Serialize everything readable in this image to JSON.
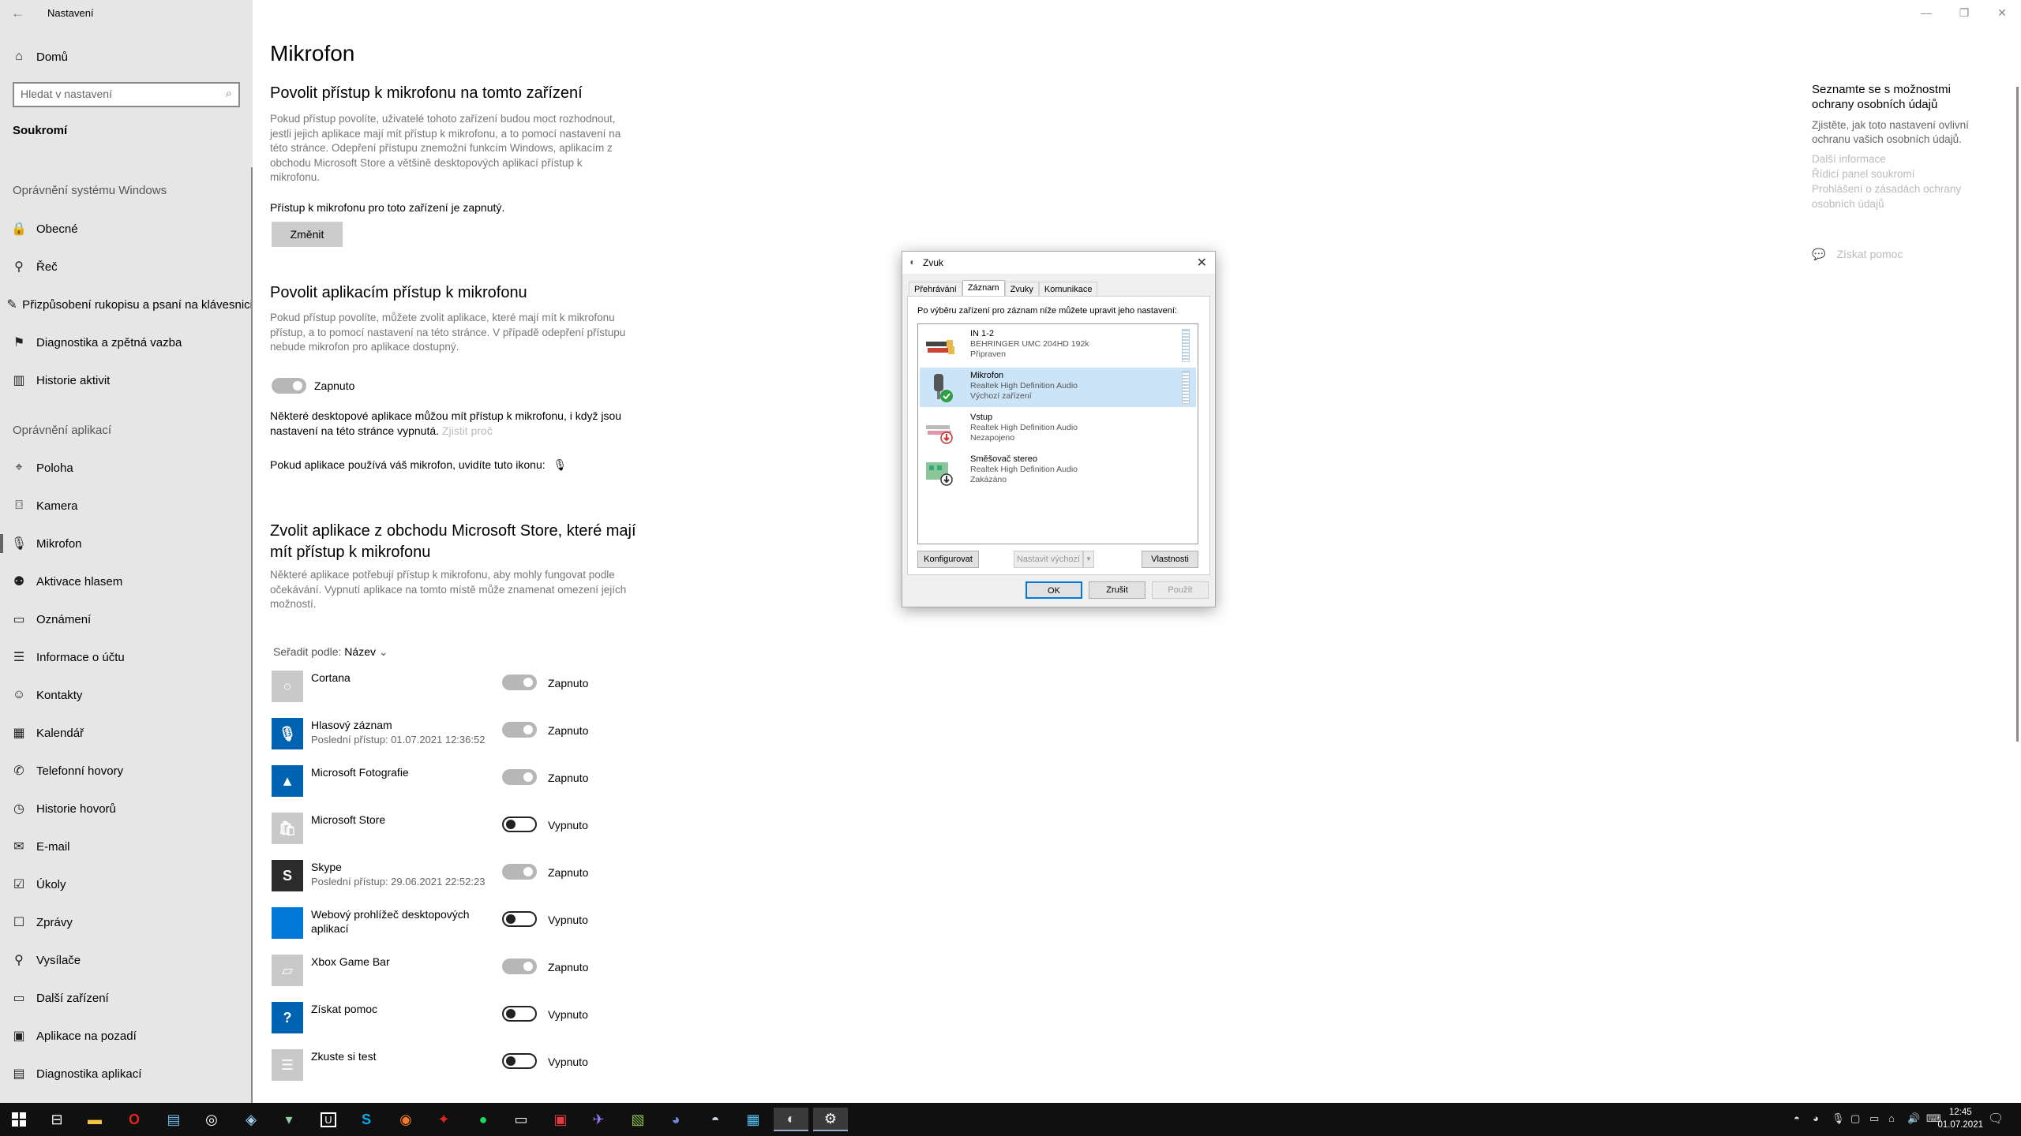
{
  "app": {
    "title": "Nastavení"
  },
  "sidebar": {
    "home": "Domů",
    "search_placeholder": "Hledat v nastavení",
    "section": "Soukromí",
    "windows_heading": "Oprávnění systému Windows",
    "windows_items": [
      {
        "label": "Obecné",
        "icon": "lock-icon"
      },
      {
        "label": "Řeč",
        "icon": "speech-icon"
      },
      {
        "label": "Přizpůsobení rukopisu a psaní na klávesnici",
        "icon": "handwriting-icon"
      },
      {
        "label": "Diagnostika a zpětná vazba",
        "icon": "diagnostics-icon"
      },
      {
        "label": "Historie aktivit",
        "icon": "activity-history-icon"
      }
    ],
    "apps_heading": "Oprávnění aplikací",
    "app_items": [
      {
        "label": "Poloha",
        "icon": "location-icon"
      },
      {
        "label": "Kamera",
        "icon": "camera-icon"
      },
      {
        "label": "Mikrofon",
        "icon": "microphone-icon",
        "active": true
      },
      {
        "label": "Aktivace hlasem",
        "icon": "voice-activation-icon"
      },
      {
        "label": "Oznámení",
        "icon": "notifications-icon"
      },
      {
        "label": "Informace o účtu",
        "icon": "account-info-icon"
      },
      {
        "label": "Kontakty",
        "icon": "contacts-icon"
      },
      {
        "label": "Kalendář",
        "icon": "calendar-icon"
      },
      {
        "label": "Telefonní hovory",
        "icon": "phone-icon"
      },
      {
        "label": "Historie hovorů",
        "icon": "call-history-icon"
      },
      {
        "label": "E-mail",
        "icon": "email-icon"
      },
      {
        "label": "Úkoly",
        "icon": "tasks-icon"
      },
      {
        "label": "Zprávy",
        "icon": "messages-icon"
      },
      {
        "label": "Vysílače",
        "icon": "radios-icon"
      },
      {
        "label": "Další zařízení",
        "icon": "other-devices-icon"
      },
      {
        "label": "Aplikace na pozadí",
        "icon": "background-apps-icon"
      },
      {
        "label": "Diagnostika aplikací",
        "icon": "app-diagnostics-icon"
      }
    ]
  },
  "main": {
    "title": "Mikrofon",
    "device_heading": "Povolit přístup k mikrofonu na tomto zařízení",
    "device_desc": "Pokud přístup povolíte, uživatelé tohoto zařízení budou moct rozhodnout, jestli jejich aplikace mají mít přístup k mikrofonu, a to pomocí nastavení na této stránce. Odepření přístupu znemožní funkcím Windows, aplikacím z obchodu Microsoft Store a většině desktopových aplikací přístup k mikrofonu.",
    "device_status": "Přístup k mikrofonu pro toto zařízení je zapnutý.",
    "change_button": "Změnit",
    "apps_heading": "Povolit aplikacím přístup k mikrofonu",
    "apps_desc": "Pokud přístup povolíte, můžete zvolit aplikace, které mají mít k mikrofonu přístup, a to pomocí nastavení na této stránce. V případě odepření přístupu nebude mikrofon pro aplikace dostupný.",
    "apps_toggle_label": "Zapnuto",
    "desktop_note": "Některé desktopové aplikace můžou mít přístup k mikrofonu, i když jsou nastavení na této stránce vypnutá.",
    "learn_why": "Zjistit proč",
    "icon_note": "Pokud aplikace používá váš mikrofon, uvidíte tuto ikonu:",
    "store_heading": "Zvolit aplikace z obchodu Microsoft Store, které mají mít přístup k mikrofonu",
    "store_desc": "Některé aplikace potřebují přístup k mikrofonu, aby mohly fungovat podle očekávání. Vypnutí aplikace na tomto místě může znamenat omezení jejích možností.",
    "sort_label": "Seřadit podle:",
    "sort_value": "Název",
    "apps": [
      {
        "name": "Cortana",
        "sub": "",
        "state": "Zapnuto",
        "on": true,
        "color": "#c9c9c9",
        "icon": "cortana-icon"
      },
      {
        "name": "Hlasový záznam",
        "sub": "Poslední přístup: 01.07.2021 12:36:52",
        "state": "Zapnuto",
        "on": true,
        "color": "#0063b1",
        "icon": "voice-recorder-icon"
      },
      {
        "name": "Microsoft Fotografie",
        "sub": "",
        "state": "Zapnuto",
        "on": true,
        "color": "#0063b1",
        "icon": "photos-icon"
      },
      {
        "name": "Microsoft Store",
        "sub": "",
        "state": "Vypnuto",
        "on": false,
        "color": "#c9c9c9",
        "icon": "store-icon"
      },
      {
        "name": "Skype",
        "sub": "Poslední přístup: 29.06.2021 22:52:23",
        "state": "Zapnuto",
        "on": true,
        "color": "#2b2b2b",
        "icon": "skype-icon"
      },
      {
        "name": "Webový prohlížeč desktopových aplikací",
        "sub": "",
        "state": "Vypnuto",
        "on": false,
        "color": "#0078d7",
        "icon": "web-viewer-icon"
      },
      {
        "name": "Xbox Game Bar",
        "sub": "",
        "state": "Zapnuto",
        "on": true,
        "color": "#c9c9c9",
        "icon": "xbox-game-bar-icon"
      },
      {
        "name": "Získat pomoc",
        "sub": "",
        "state": "Vypnuto",
        "on": false,
        "color": "#0063b1",
        "icon": "get-help-icon"
      },
      {
        "name": "Zkuste si test",
        "sub": "",
        "state": "Vypnuto",
        "on": false,
        "color": "#c9c9c9",
        "icon": "try-test-icon"
      }
    ]
  },
  "related": {
    "title": "Seznamte se s možnostmi ochrany osobních údajů",
    "desc": "Zjistěte, jak toto nastavení ovlivní ochranu vašich osobních údajů.",
    "links": [
      "Další informace",
      "Řídicí panel soukromí",
      "Prohlášení o zásadách ochrany osobních údajů"
    ],
    "help": "Získat pomoc"
  },
  "dialog": {
    "title": "Zvuk",
    "tabs": [
      "Přehrávání",
      "Záznam",
      "Zvuky",
      "Komunikace"
    ],
    "active_tab": 1,
    "instruction": "Po výběru zařízení pro záznam níže můžete upravit jeho nastavení:",
    "devices": [
      {
        "name": "IN 1-2",
        "desc": "BEHRINGER UMC 204HD 192k",
        "status": "Připraven",
        "selected": false,
        "icon": "rca-cable-icon"
      },
      {
        "name": "Mikrofon",
        "desc": "Realtek High Definition Audio",
        "status": "Výchozí zařízení",
        "selected": true,
        "icon": "microphone-device-icon"
      },
      {
        "name": "Vstup",
        "desc": "Realtek High Definition Audio",
        "status": "Nezapojeno",
        "selected": false,
        "icon": "line-in-icon"
      },
      {
        "name": "Směšovač stereo",
        "desc": "Realtek High Definition Audio",
        "status": "Zakázáno",
        "selected": false,
        "icon": "stereo-mix-icon"
      }
    ],
    "configure": "Konfigurovat",
    "set_default": "Nastavit výchozí",
    "properties": "Vlastnosti",
    "ok": "OK",
    "cancel": "Zrušit",
    "apply": "Použít"
  },
  "taskbar": {
    "clock_time": "12:45",
    "clock_date": "01.07.2021"
  }
}
